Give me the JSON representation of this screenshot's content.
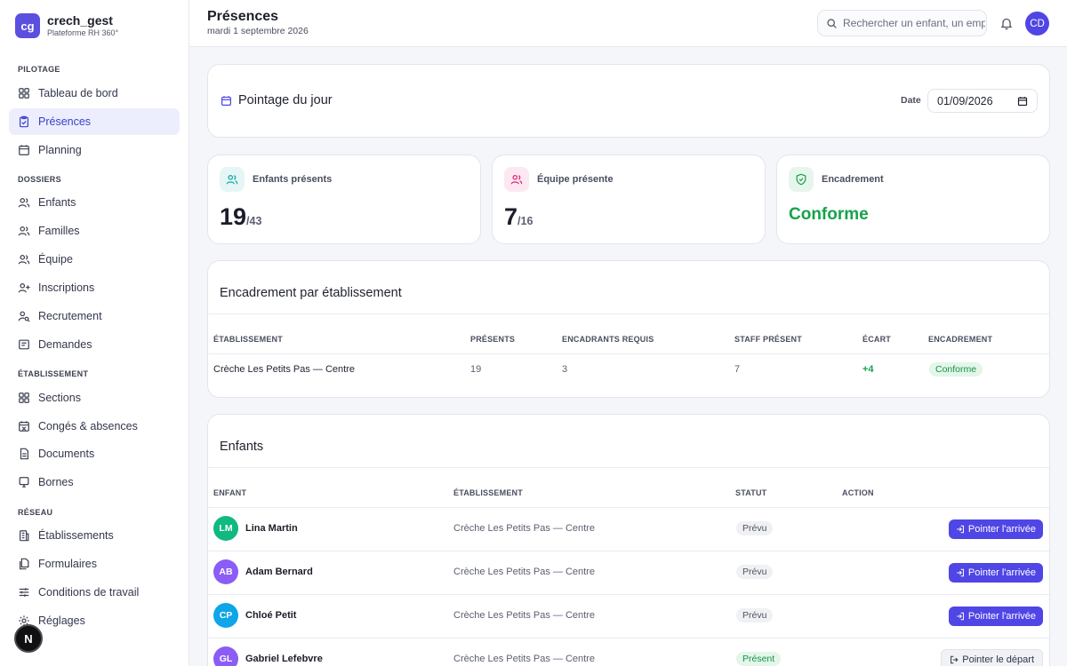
{
  "brand": {
    "logo": "cg",
    "name": "crech_gest",
    "subtitle": "Plateforme RH 360°"
  },
  "sidebar": {
    "sections": [
      {
        "title": "PILOTAGE"
      },
      {
        "title": "DOSSIERS"
      },
      {
        "title": "ÉTABLISSEMENT"
      },
      {
        "title": "RÉSEAU"
      }
    ],
    "items": [
      {
        "label": "Tableau de bord",
        "icon": "grid-icon"
      },
      {
        "label": "Présences",
        "icon": "clipboard-check-icon",
        "active": true
      },
      {
        "label": "Planning",
        "icon": "calendar-icon"
      },
      {
        "label": "Enfants",
        "icon": "users-icon"
      },
      {
        "label": "Familles",
        "icon": "users-icon"
      },
      {
        "label": "Équipe",
        "icon": "users-icon"
      },
      {
        "label": "Inscriptions",
        "icon": "user-plus-icon"
      },
      {
        "label": "Recrutement",
        "icon": "user-search-icon"
      },
      {
        "label": "Demandes",
        "icon": "message-square-icon"
      },
      {
        "label": "Sections",
        "icon": "grid-icon"
      },
      {
        "label": "Congés & absences",
        "icon": "calendar-x-icon"
      },
      {
        "label": "Documents",
        "icon": "file-icon"
      },
      {
        "label": "Bornes",
        "icon": "tablet-icon"
      },
      {
        "label": "Établissements",
        "icon": "building-icon"
      },
      {
        "label": "Formulaires",
        "icon": "files-icon"
      },
      {
        "label": "Conditions de travail",
        "icon": "sliders-icon"
      },
      {
        "label": "Réglages",
        "icon": "gear-icon"
      }
    ],
    "dev_badge": "N"
  },
  "header": {
    "title": "Présences",
    "date": "mardi 1 septembre 2026",
    "search_placeholder": "Rechercher un enfant, un employé…",
    "avatar": "CD"
  },
  "pointage": {
    "title": "Pointage du jour",
    "date_label": "Date",
    "date_value": "01/09/2026"
  },
  "stats": [
    {
      "label": "Enfants présents",
      "value": "19",
      "total": "/43",
      "icon": "users-icon",
      "accent": "#0ea5a5"
    },
    {
      "label": "Équipe présente",
      "value": "7",
      "total": "/16",
      "icon": "users-icon",
      "accent": "#db2777"
    },
    {
      "label": "Encadrement",
      "value": "Conforme",
      "icon": "shield-check-icon",
      "accent": "#16a34a"
    }
  ],
  "encadrement": {
    "title": "Encadrement par établissement",
    "columns": [
      "ÉTABLISSEMENT",
      "PRÉSENTS",
      "ENCADRANTS REQUIS",
      "STAFF PRÉSENT",
      "ÉCART",
      "ENCADREMENT"
    ],
    "rows": [
      {
        "etablissement": "Crèche Les Petits Pas — Centre",
        "presents": "19",
        "requis": "3",
        "staff": "7",
        "ecart": "+4",
        "statut": "Conforme"
      }
    ]
  },
  "enfants": {
    "title": "Enfants",
    "columns": [
      "ENFANT",
      "ÉTABLISSEMENT",
      "STATUT",
      "ACTION"
    ],
    "rows": [
      {
        "initials": "LM",
        "color": "#10b981",
        "name": "Lina Martin",
        "etablissement": "Crèche Les Petits Pas — Centre",
        "statut": "Prévu",
        "action": "Pointer l'arrivée"
      },
      {
        "initials": "AB",
        "color": "#8b5cf6",
        "name": "Adam Bernard",
        "etablissement": "Crèche Les Petits Pas — Centre",
        "statut": "Prévu",
        "action": "Pointer l'arrivée"
      },
      {
        "initials": "CP",
        "color": "#0ea5e9",
        "name": "Chloé Petit",
        "etablissement": "Crèche Les Petits Pas — Centre",
        "statut": "Prévu",
        "action": "Pointer l'arrivée"
      },
      {
        "initials": "GL",
        "color": "#8b5cf6",
        "name": "Gabriel Lefebvre",
        "etablissement": "Crèche Les Petits Pas — Centre",
        "statut": "Présent",
        "action": "Pointer le départ"
      }
    ]
  }
}
